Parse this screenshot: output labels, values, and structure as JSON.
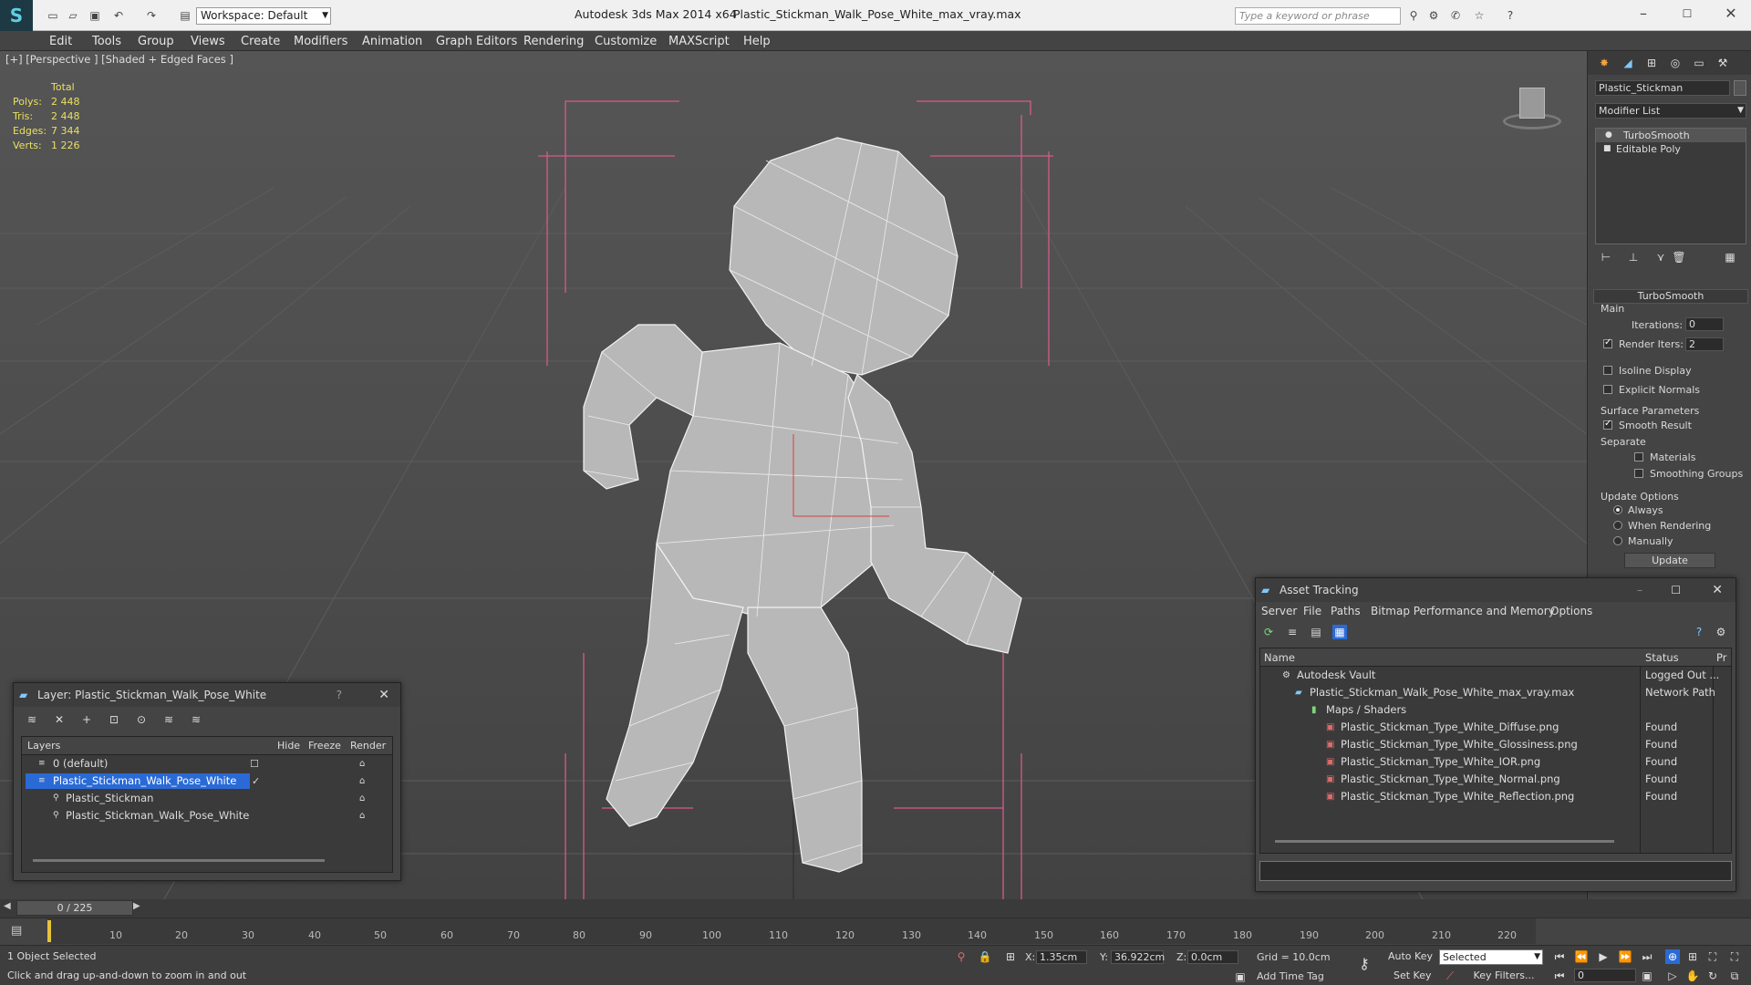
{
  "titlebar": {
    "app_title": "Autodesk 3ds Max  2014 x64",
    "file_title": "Plastic_Stickman_Walk_Pose_White_max_vray.max",
    "workspace": "Workspace: Default",
    "search_placeholder": "Type a keyword or phrase"
  },
  "menu": [
    "Edit",
    "Tools",
    "Group",
    "Views",
    "Create",
    "Modifiers",
    "Animation",
    "Graph Editors",
    "Rendering",
    "Customize",
    "MAXScript",
    "Help"
  ],
  "viewport": {
    "label": "[+] [Perspective ] [Shaded + Edged Faces ]",
    "stats_header": "Total",
    "stats": [
      {
        "label": "Polys:",
        "value": "2 448"
      },
      {
        "label": "Tris:",
        "value": "2 448"
      },
      {
        "label": "Edges:",
        "value": "7 344"
      },
      {
        "label": "Verts:",
        "value": "1 226"
      }
    ]
  },
  "command_panel": {
    "object_name": "Plastic_Stickman",
    "modifier_list": "Modifier List",
    "stack": [
      "TurboSmooth",
      "Editable Poly"
    ],
    "rollout_title": "TurboSmooth",
    "main_label": "Main",
    "iterations_label": "Iterations:",
    "iterations_value": "0",
    "render_iters_label": "Render Iters:",
    "render_iters_value": "2",
    "isoline": "Isoline Display",
    "explicit_normals": "Explicit Normals",
    "surface_params": "Surface Parameters",
    "smooth_result": "Smooth Result",
    "separate": "Separate",
    "materials": "Materials",
    "smoothing_groups": "Smoothing Groups",
    "update_options": "Update Options",
    "always": "Always",
    "when_rendering": "When Rendering",
    "manually": "Manually",
    "update_button": "Update"
  },
  "layer_dialog": {
    "title": "Layer: Plastic_Stickman_Walk_Pose_White",
    "help": "?",
    "columns": [
      "Layers",
      "Hide",
      "Freeze",
      "Render"
    ],
    "rows": [
      "0 (default)",
      "Plastic_Stickman_Walk_Pose_White",
      "Plastic_Stickman",
      "Plastic_Stickman_Walk_Pose_White"
    ]
  },
  "asset_dialog": {
    "title": "Asset Tracking",
    "menu": [
      "Server",
      "File",
      "Paths",
      "Bitmap Performance and Memory",
      "Options"
    ],
    "columns": [
      "Name",
      "Status",
      "Pr"
    ],
    "rows": [
      {
        "name": "Autodesk Vault",
        "status": "Logged Out ..."
      },
      {
        "name": "Plastic_Stickman_Walk_Pose_White_max_vray.max",
        "status": "Network Path"
      },
      {
        "name": "Maps / Shaders",
        "status": ""
      },
      {
        "name": "Plastic_Stickman_Type_White_Diffuse.png",
        "status": "Found"
      },
      {
        "name": "Plastic_Stickman_Type_White_Glossiness.png",
        "status": "Found"
      },
      {
        "name": "Plastic_Stickman_Type_White_IOR.png",
        "status": "Found"
      },
      {
        "name": "Plastic_Stickman_Type_White_Normal.png",
        "status": "Found"
      },
      {
        "name": "Plastic_Stickman_Type_White_Reflection.png",
        "status": "Found"
      }
    ]
  },
  "timeline": {
    "frame": "0 / 225",
    "ticks": [
      "10",
      "20",
      "30",
      "40",
      "50",
      "60",
      "70",
      "80",
      "90",
      "100",
      "110",
      "120",
      "130",
      "140",
      "150",
      "160",
      "170",
      "180",
      "190",
      "200",
      "210",
      "220"
    ]
  },
  "status": {
    "selection": "1 Object Selected",
    "prompt": "Click and drag up-and-down to zoom in and out",
    "x_label": "X:",
    "x_value": "1.35cm",
    "y_label": "Y:",
    "y_value": "36.922cm",
    "z_label": "Z:",
    "z_value": "0.0cm",
    "grid": "Grid = 10.0cm",
    "add_time_tag": "Add Time Tag",
    "auto_key": "Auto Key",
    "set_key": "Set Key",
    "selected": "Selected",
    "key_filters": "Key Filters...",
    "frame_value": "0"
  }
}
